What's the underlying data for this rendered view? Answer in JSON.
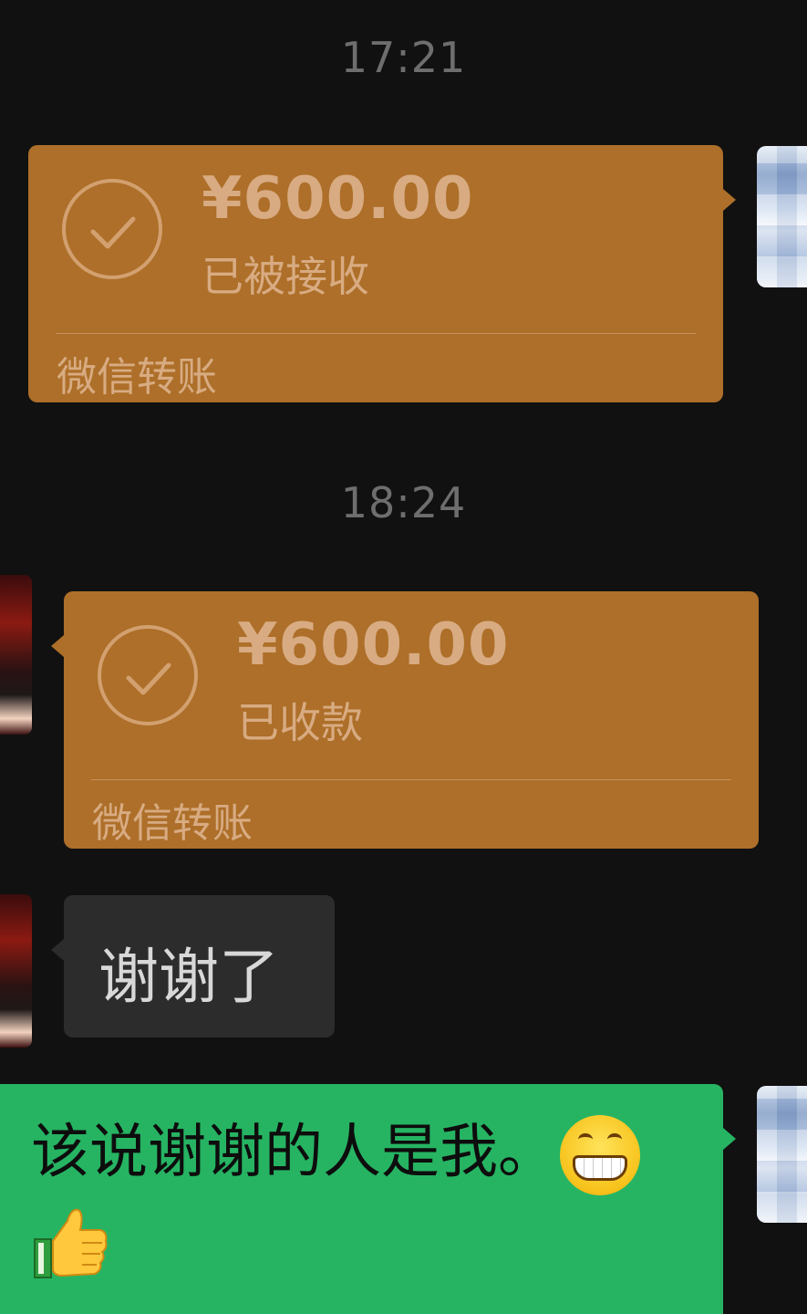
{
  "timestamps": [
    "17:21",
    "18:24"
  ],
  "messages": {
    "transfer_sent": {
      "amount": "¥600.00",
      "status": "已被接收",
      "label": "微信转账",
      "colors": {
        "bubble": "#ad6f29",
        "text": "#d8ab82"
      }
    },
    "transfer_received": {
      "amount": "¥600.00",
      "status": "已收款",
      "label": "微信转账"
    },
    "reply_left": {
      "text": "谢谢了",
      "color": "#2c2c2c"
    },
    "reply_right": {
      "text": "该说谢谢的人是我。",
      "emojis": [
        "grinning-face-icon",
        "thumbs-up-icon"
      ],
      "color": "#26b463"
    }
  }
}
